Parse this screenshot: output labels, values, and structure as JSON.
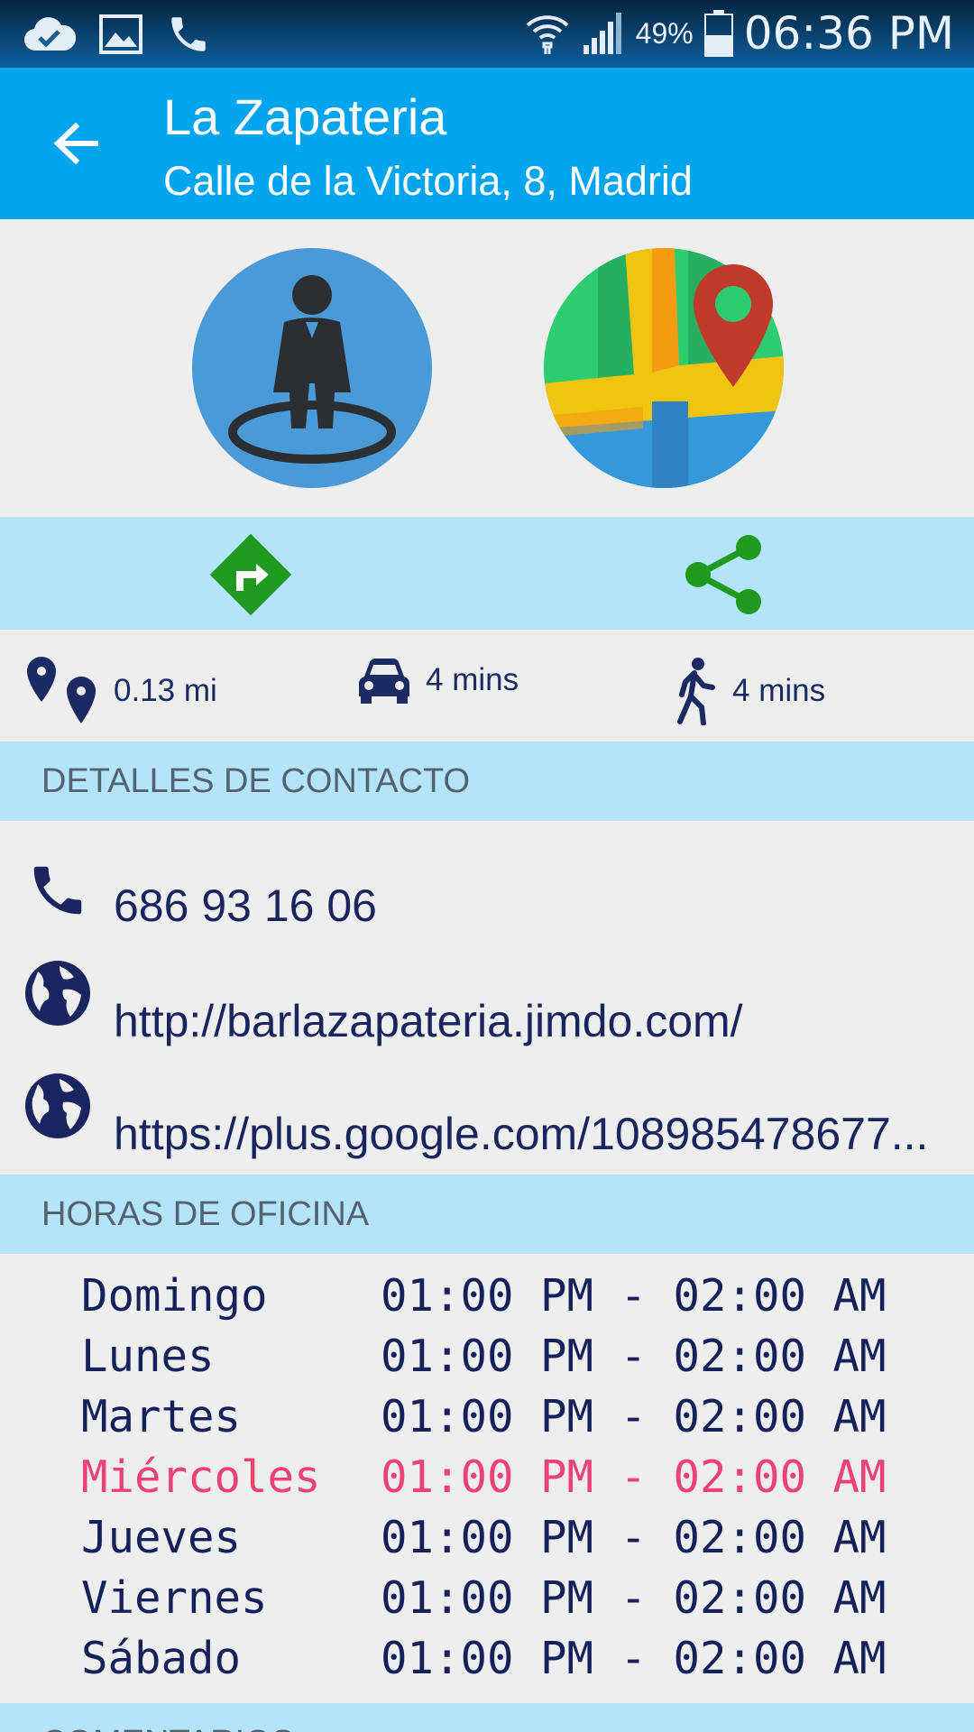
{
  "status_bar": {
    "battery": "49%",
    "time": "06:36 PM",
    "icons": [
      "cloud-check-icon",
      "image-icon",
      "phone-icon",
      "wifi-icon",
      "signal-icon",
      "battery-icon"
    ]
  },
  "app_bar": {
    "title": "La Zapateria",
    "subtitle": "Calle de la Victoria, 8, Madrid"
  },
  "hero": {
    "icons": [
      "street-view-icon",
      "map-location-icon"
    ]
  },
  "actions": {
    "icons": [
      "directions-icon",
      "share-icon"
    ]
  },
  "travel": {
    "distance": "0.13 mi",
    "drive_time": "4 mins",
    "walk_time": "4 mins"
  },
  "contact": {
    "header": "DETALLES DE CONTACTO",
    "phone": "686 93 16 06",
    "website": "http://barlazapateria.jimdo.com/",
    "google_plus": "https://plus.google.com/108985478677..."
  },
  "hours": {
    "header": "HORAS DE OFICINA",
    "days": [
      {
        "day": "Domingo",
        "time": "01:00 PM - 02:00 AM"
      },
      {
        "day": "Lunes",
        "time": "01:00 PM - 02:00 AM"
      },
      {
        "day": "Martes",
        "time": "01:00 PM - 02:00 AM"
      },
      {
        "day": "Miércoles",
        "time": "01:00 PM - 02:00 AM"
      },
      {
        "day": "Jueves",
        "time": "01:00 PM - 02:00 AM"
      },
      {
        "day": "Viernes",
        "time": "01:00 PM - 02:00 AM"
      },
      {
        "day": "Sábado",
        "time": "01:00 PM - 02:00 AM"
      }
    ],
    "highlight_color": "#ee4277"
  },
  "comments": {
    "header": "COMENTARIOS"
  },
  "colors": {
    "app_bar": "#04a5ef",
    "section_bg": "#b3e4fa",
    "icon_green": "#1f9a1f",
    "text_navy": "#1a2560"
  }
}
